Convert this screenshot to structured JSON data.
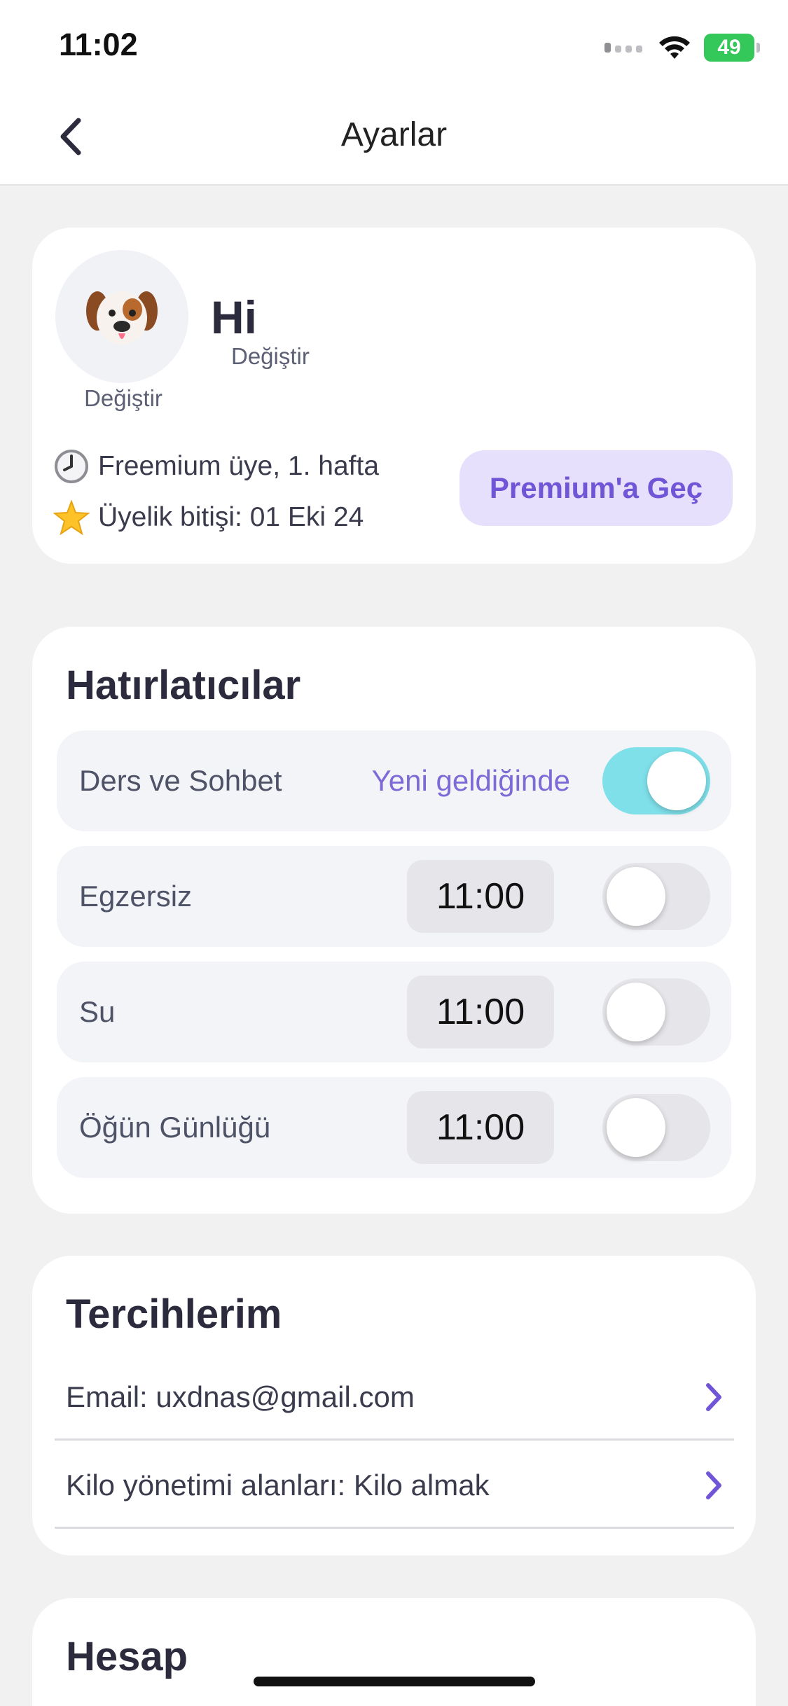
{
  "status_bar": {
    "time": "11:02",
    "battery": "49"
  },
  "nav": {
    "title": "Ayarlar"
  },
  "profile": {
    "avatar_emoji": "🐶",
    "avatar_change": "Değiştir",
    "name": "Hi",
    "name_change": "Değiştir",
    "membership": "Freemium üye, 1. hafta",
    "membership_emoji": "🕚",
    "expiry": "Üyelik bitişi: 01 Eki 24",
    "expiry_emoji": "⭐",
    "premium_button": "Premium'a Geç"
  },
  "reminders": {
    "title": "Hatırlatıcılar",
    "items": [
      {
        "label": "Ders ve Sohbet",
        "note": "Yeni geldiğinde",
        "enabled": true
      },
      {
        "label": "Egzersiz",
        "time": "11:00",
        "enabled": false
      },
      {
        "label": "Su",
        "time": "11:00",
        "enabled": false
      },
      {
        "label": "Öğün Günlüğü",
        "time": "11:00",
        "enabled": false
      }
    ]
  },
  "preferences": {
    "title": "Tercihlerim",
    "items": [
      {
        "label": "Email: uxdnas@gmail.com"
      },
      {
        "label": "Kilo yönetimi alanları: Kilo almak"
      }
    ]
  },
  "account": {
    "title": "Hesap"
  },
  "colors": {
    "accent": "#7055d6",
    "premium_bg": "#e6e0fd",
    "toggle_on": "#7fe0ea",
    "background": "#f1f1f2"
  }
}
